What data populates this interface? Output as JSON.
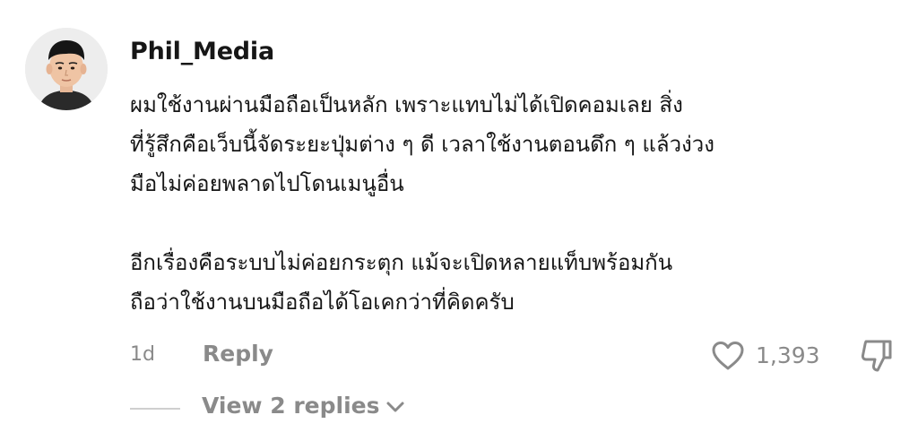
{
  "comment": {
    "username": "Phil_Media",
    "paragraphs": [
      "ผมใช้งานผ่านมือถือเป็นหลัก เพราะแทบไม่ได้เปิดคอมเลย สิ่ง\nที่รู้สึกคือเว็บนี้จัดระยะปุ่มต่าง ๆ ดี เวลาใช้งานตอนดึก ๆ แล้วง่วง\nมือไม่ค่อยพลาดไปโดนเมนูอื่น",
      "อีกเรื่องคือระบบไม่ค่อยกระตุก แม้จะเปิดหลายแท็บพร้อมกัน\nถือว่าใช้งานบนมือถือได้โอเคกว่าที่คิดครับ"
    ],
    "timestamp": "1d",
    "reply_label": "Reply",
    "like_count": "1,393",
    "view_replies_label": "View 2 replies"
  },
  "icons": {
    "like": "heart-outline-icon",
    "dislike": "thumbs-down-icon",
    "expand": "chevron-down-icon"
  },
  "colors": {
    "text": "#161616",
    "muted": "#8a8a8a",
    "avatar_bg": "#ededed"
  }
}
